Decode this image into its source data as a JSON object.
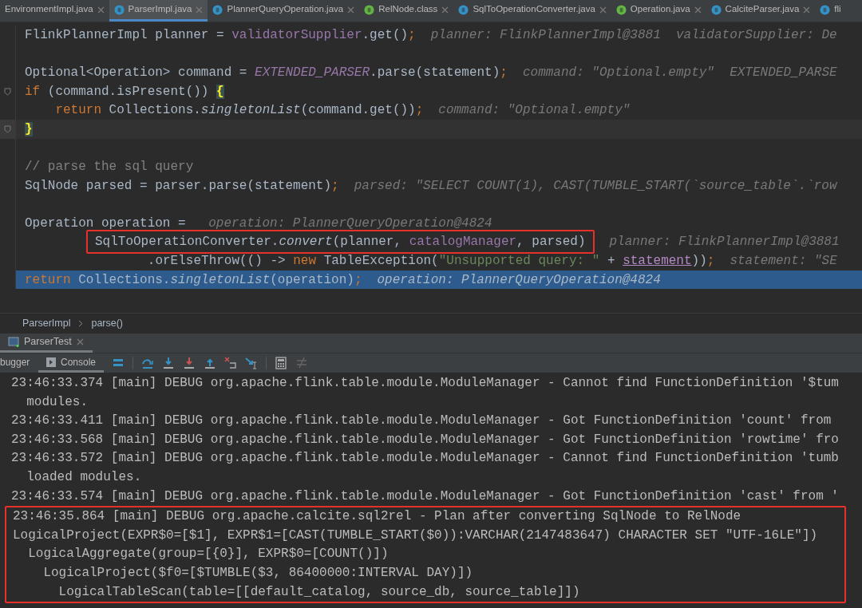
{
  "editor_tabs": [
    {
      "label": "EnvironmentImpl.java",
      "kind": "none",
      "selected": false
    },
    {
      "label": "ParserImpl.java",
      "kind": "class",
      "selected": true
    },
    {
      "label": "PlannerQueryOperation.java",
      "kind": "class",
      "selected": false
    },
    {
      "label": "RelNode.class",
      "kind": "interface",
      "selected": false
    },
    {
      "label": "SqlToOperationConverter.java",
      "kind": "class",
      "selected": false
    },
    {
      "label": "Operation.java",
      "kind": "interface",
      "selected": false
    },
    {
      "label": "CalciteParser.java",
      "kind": "class",
      "selected": false
    },
    {
      "label": "fli",
      "kind": "class",
      "selected": false
    }
  ],
  "code_lines": [
    {
      "kind": "code",
      "fold": false,
      "current": false,
      "selected": false,
      "tokens": [
        {
          "kind": "plain",
          "text": "FlinkPlannerImpl planner = "
        },
        {
          "kind": "field",
          "text": "validatorSupplier"
        },
        {
          "kind": "plain",
          "text": ".get()"
        },
        {
          "kind": "keyword",
          "text": ";"
        }
      ],
      "hint": "planner: FlinkPlannerImpl@3881  validatorSupplier: De"
    },
    {
      "kind": "blank",
      "fold": false,
      "current": false,
      "selected": false
    },
    {
      "kind": "code",
      "fold": false,
      "current": false,
      "selected": false,
      "tokens": [
        {
          "kind": "plain",
          "text": "Optional<Operation> command = "
        },
        {
          "kind": "static",
          "text": "EXTENDED_PARSER"
        },
        {
          "kind": "plain",
          "text": ".parse(statement)"
        },
        {
          "kind": "keyword",
          "text": ";"
        }
      ],
      "hint": "command: \"Optional.empty\"  EXTENDED_PARSE"
    },
    {
      "kind": "code",
      "fold": true,
      "current": false,
      "selected": false,
      "tokens": [
        {
          "kind": "keyword",
          "text": "if"
        },
        {
          "kind": "plain",
          "text": " (command.isPresent()) "
        },
        {
          "kind": "brace",
          "text": "{"
        }
      ]
    },
    {
      "kind": "code",
      "fold": false,
      "current": false,
      "selected": false,
      "tokens": [
        {
          "kind": "keyword",
          "text": "    return"
        },
        {
          "kind": "plain",
          "text": " Collections."
        },
        {
          "kind": "method",
          "text": "singletonList"
        },
        {
          "kind": "plain",
          "text": "(command.get())"
        },
        {
          "kind": "keyword",
          "text": ";"
        }
      ],
      "hint": "command: \"Optional.empty\""
    },
    {
      "kind": "code",
      "fold": true,
      "current": true,
      "selected": false,
      "tokens": [
        {
          "kind": "brace",
          "text": "}"
        }
      ]
    },
    {
      "kind": "blank",
      "fold": false,
      "current": false,
      "selected": false
    },
    {
      "kind": "code",
      "fold": false,
      "current": false,
      "selected": false,
      "tokens": [
        {
          "kind": "comment",
          "text": "// parse the sql query"
        }
      ]
    },
    {
      "kind": "code",
      "fold": false,
      "current": false,
      "selected": false,
      "tokens": [
        {
          "kind": "plain",
          "text": "SqlNode parsed = parser.parse(statement)"
        },
        {
          "kind": "keyword",
          "text": ";"
        }
      ],
      "hint": "parsed: \"SELECT COUNT(1), CAST(TUMBLE_START(`source_table`.`row"
    },
    {
      "kind": "blank",
      "fold": false,
      "current": false,
      "selected": false
    },
    {
      "kind": "code",
      "fold": false,
      "current": false,
      "selected": false,
      "tokens": [
        {
          "kind": "plain",
          "text": "Operation operation = "
        }
      ],
      "hint": "operation: PlannerQueryOperation@4824"
    },
    {
      "kind": "continuation",
      "fold": false,
      "current": false,
      "selected": false,
      "boxed": true,
      "tokens": [
        {
          "kind": "plain",
          "text": "SqlToOperationConverter."
        },
        {
          "kind": "method",
          "text": "convert"
        },
        {
          "kind": "plain",
          "text": "(planner, "
        },
        {
          "kind": "field",
          "text": "catalogManager"
        },
        {
          "kind": "plain",
          "text": ", parsed)"
        }
      ],
      "hint": "planner: FlinkPlannerImpl@3881"
    },
    {
      "kind": "continuation",
      "fold": false,
      "current": false,
      "selected": false,
      "boxed": false,
      "tokens": [
        {
          "kind": "plain",
          "text": "        .orElseThrow(() -> "
        },
        {
          "kind": "keyword",
          "text": "new"
        },
        {
          "kind": "plain",
          "text": " TableException("
        },
        {
          "kind": "string",
          "text": "\"Unsupported query: \""
        },
        {
          "kind": "plain",
          "text": " + "
        },
        {
          "kind": "underlined",
          "text": "statement"
        },
        {
          "kind": "plain",
          "text": "))"
        },
        {
          "kind": "keyword",
          "text": ";"
        }
      ],
      "hint": "statement: \"SE"
    },
    {
      "kind": "code",
      "fold": false,
      "current": false,
      "selected": true,
      "tokens": [
        {
          "kind": "keyword",
          "text": "return"
        },
        {
          "kind": "plain",
          "text": " Collections."
        },
        {
          "kind": "method",
          "text": "singletonList"
        },
        {
          "kind": "plain",
          "text": "(operation)"
        },
        {
          "kind": "keyword",
          "text": ";"
        }
      ],
      "hint": "operation: PlannerQueryOperation@4824"
    }
  ],
  "breadcrumb": [
    "ParserImpl",
    "parse()"
  ],
  "run_tab": {
    "label": "ParserTest"
  },
  "debug_tabs": [
    {
      "label": "bugger",
      "selected": false
    },
    {
      "label": "Console",
      "selected": true
    }
  ],
  "console_lines": [
    {
      "text": "23:46:33.374 [main] DEBUG org.apache.flink.table.module.ModuleManager - Cannot find FunctionDefinition '$tum",
      "boxed": false
    },
    {
      "text": "  modules.",
      "boxed": false
    },
    {
      "text": "23:46:33.411 [main] DEBUG org.apache.flink.table.module.ModuleManager - Got FunctionDefinition 'count' from",
      "boxed": false
    },
    {
      "text": "23:46:33.568 [main] DEBUG org.apache.flink.table.module.ModuleManager - Got FunctionDefinition 'rowtime' fro",
      "boxed": false
    },
    {
      "text": "23:46:33.572 [main] DEBUG org.apache.flink.table.module.ModuleManager - Cannot find FunctionDefinition 'tumb",
      "boxed": false
    },
    {
      "text": "  loaded modules.",
      "boxed": false
    },
    {
      "text": "23:46:33.574 [main] DEBUG org.apache.flink.table.module.ModuleManager - Got FunctionDefinition 'cast' from '",
      "boxed": false
    },
    {
      "text": "23:46:35.864 [main] DEBUG org.apache.calcite.sql2rel - Plan after converting SqlNode to RelNode",
      "boxed": true
    },
    {
      "text": "LogicalProject(EXPR$0=[$1], EXPR$1=[CAST(TUMBLE_START($0)):VARCHAR(2147483647) CHARACTER SET \"UTF-16LE\"])",
      "boxed": true
    },
    {
      "text": "  LogicalAggregate(group=[{0}], EXPR$0=[COUNT()])",
      "boxed": true
    },
    {
      "text": "    LogicalProject($f0=[$TUMBLE($3, 86400000:INTERVAL DAY)])",
      "boxed": true
    },
    {
      "text": "      LogicalTableScan(table=[[default_catalog, source_db, source_table]])",
      "boxed": true
    }
  ]
}
